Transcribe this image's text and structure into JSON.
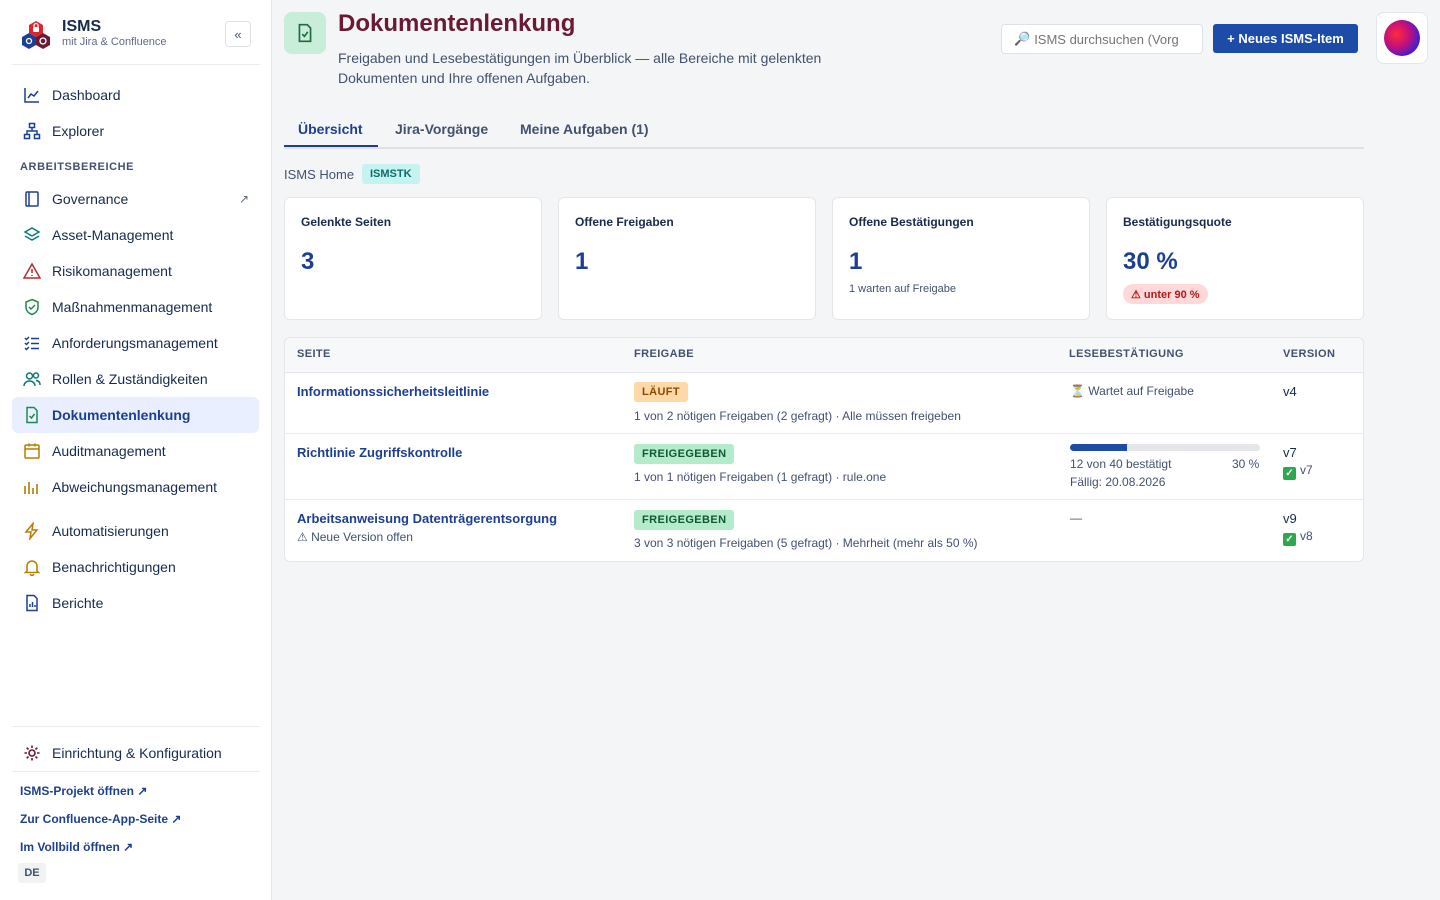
{
  "brand": {
    "title": "ISMS",
    "subtitle": "mit Jira & Confluence",
    "collapse": "«"
  },
  "sidebar": {
    "items_top": [
      {
        "label": "Dashboard",
        "icon": "chart-line-icon"
      },
      {
        "label": "Explorer",
        "icon": "hierarchy-icon"
      }
    ],
    "section_label": "ARBEITSBEREICHE",
    "items": [
      {
        "label": "Governance",
        "icon": "book-icon",
        "ext": "↗"
      },
      {
        "label": "Asset-Management",
        "icon": "layers-icon"
      },
      {
        "label": "Risikomanagement",
        "icon": "warning-icon"
      },
      {
        "label": "Maßnahmenmanagement",
        "icon": "shield-check-icon"
      },
      {
        "label": "Anforderungsmanagement",
        "icon": "checklist-icon"
      },
      {
        "label": "Rollen & Zuständigkeiten",
        "icon": "people-icon"
      },
      {
        "label": "Dokumentenlenkung",
        "icon": "document-check-icon",
        "active": true
      },
      {
        "label": "Auditmanagement",
        "icon": "calendar-icon"
      },
      {
        "label": "Abweichungsmanagement",
        "icon": "bar-chart-icon"
      }
    ],
    "items_extra": [
      {
        "label": "Automatisierungen",
        "icon": "lightning-icon"
      },
      {
        "label": "Benachrichtigungen",
        "icon": "bell-icon"
      },
      {
        "label": "Berichte",
        "icon": "report-icon"
      }
    ],
    "settings": {
      "label": "Einrichtung & Konfiguration",
      "icon": "settings-icon"
    },
    "links": [
      "ISMS-Projekt öffnen ↗",
      "Zur Confluence-App-Seite ↗",
      "Im Vollbild öffnen ↗"
    ],
    "language": "DE"
  },
  "header": {
    "title": "Dokumentenlenkung",
    "description": "Freigaben und Lesebestätigungen im Überblick — alle Bereiche mit gelenkten Dokumenten und Ihre offenen Aufgaben.",
    "search_placeholder": "ISMS durchsuchen (Vorg",
    "new_button": "+ Neues ISMS-Item"
  },
  "tabs": [
    "Übersicht",
    "Jira-Vorgänge",
    "Meine Aufgaben (1)"
  ],
  "breadcrumb": {
    "label": "ISMS Home",
    "badge": "ISMSTK"
  },
  "stats": [
    {
      "title": "Gelenkte Seiten",
      "value": "3"
    },
    {
      "title": "Offene Freigaben",
      "value": "1"
    },
    {
      "title": "Offene Bestätigungen",
      "value": "1",
      "note": "1 warten auf Freigabe"
    },
    {
      "title": "Bestätigungsquote",
      "value": "30 %",
      "badge": "⚠ unter 90 %"
    }
  ],
  "table": {
    "headers": [
      "SEITE",
      "FREIGABE",
      "LESEBESTÄTIGUNG",
      "VERSION"
    ],
    "rows": [
      {
        "page": "Informationssicherheitsleitlinie",
        "status": "LÄUFT",
        "status_type": "running",
        "approval_text": "1 von 2 nötigen Freigaben (2 gefragt) · Alle müssen freigeben",
        "read": "⏳ Wartet auf Freigabe",
        "version": "v4"
      },
      {
        "page": "Richtlinie Zugriffskontrolle",
        "status": "FREIGEGEBEN",
        "status_type": "approved",
        "approval_text": "1 von 1 nötigen Freigaben (1 gefragt) · rule.one",
        "progress": 0.3,
        "read_count": "12 von 40 bestätigt",
        "read_percent": "30 %",
        "due": "Fällig: 20.08.2026",
        "version": "v7",
        "approved_version": "v7"
      },
      {
        "page": "Arbeitsanweisung Datenträgerentsorgung",
        "page_note": "⚠ Neue Version offen",
        "status": "FREIGEGEBEN",
        "status_type": "approved",
        "approval_text": "3 von 3 nötigen Freigaben (5 gefragt) · Mehrheit (mehr als 50 %)",
        "read": "—",
        "version": "v9",
        "approved_version": "v8"
      }
    ]
  },
  "colors": {
    "accent": "#1d4ba8",
    "title": "#6b1a33",
    "running": "#ffd8a8",
    "approved": "#b3ebcb",
    "warning_badge": "#ffd9d9"
  }
}
